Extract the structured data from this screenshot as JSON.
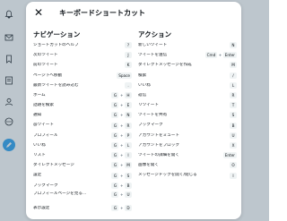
{
  "modal": {
    "title": "キーボードショートカット",
    "close_glyph": "✕"
  },
  "background_icons": [
    "bell-icon",
    "mail-icon",
    "bookmark-icon",
    "list-icon",
    "profile-icon",
    "more-icon"
  ],
  "navigation": {
    "heading": "ナビゲーション",
    "rows": [
      {
        "label": "ショートカットのヘルプ",
        "keys": [
          "?"
        ]
      },
      {
        "label": "次のツイート",
        "keys": [
          "J"
        ]
      },
      {
        "label": "前のツイート",
        "keys": [
          "K"
        ]
      },
      {
        "label": "ページ下へ移動",
        "keys": [
          "Space"
        ]
      },
      {
        "label": "最新ツイートを読み込む",
        "keys": [
          "."
        ]
      },
      {
        "label": "ホーム",
        "keys": [
          "G",
          "H"
        ]
      },
      {
        "label": "話題を検索",
        "keys": [
          "G",
          "E"
        ]
      },
      {
        "label": "通知",
        "keys": [
          "G",
          "N"
        ]
      },
      {
        "label": "@ツイート",
        "keys": [
          "G",
          "R"
        ]
      },
      {
        "label": "プロフィール",
        "keys": [
          "G",
          "P"
        ]
      },
      {
        "label": "いいね",
        "keys": [
          "G",
          "L"
        ]
      },
      {
        "label": "リスト",
        "keys": [
          "G",
          "I"
        ]
      },
      {
        "label": "ダイレクトメッセージ",
        "keys": [
          "G",
          "M"
        ]
      },
      {
        "label": "設定",
        "keys": [
          "G",
          "S"
        ]
      },
      {
        "label": "ブックマーク",
        "keys": [
          "G",
          "B"
        ]
      },
      {
        "label": "プロフィールページを見る...",
        "keys": [
          "G",
          "U"
        ]
      },
      {
        "label": "表示設定",
        "keys": [
          "G",
          "D"
        ]
      }
    ]
  },
  "actions": {
    "heading": "アクション",
    "rows": [
      {
        "label": "新しいツイート",
        "keys": [
          "N"
        ]
      },
      {
        "label": "ツイートを送信",
        "keys": [
          "Cmd",
          "Enter"
        ]
      },
      {
        "label": "ダイレクトメッセージを作成",
        "keys": [
          "M"
        ]
      },
      {
        "label": "検索",
        "keys": [
          "/"
        ]
      },
      {
        "label": "いいね",
        "keys": [
          "L"
        ]
      },
      {
        "label": "返信",
        "keys": [
          "R"
        ]
      },
      {
        "label": "リツイート",
        "keys": [
          "T"
        ]
      },
      {
        "label": "ツイートを共有",
        "keys": [
          "S"
        ]
      },
      {
        "label": "ブックマーク",
        "keys": [
          "B"
        ]
      },
      {
        "label": "アカウントをミュート",
        "keys": [
          "U"
        ]
      },
      {
        "label": "アカウントをブロック",
        "keys": [
          "X"
        ]
      },
      {
        "label": "ツイートの詳細を開く",
        "keys": [
          "Enter"
        ]
      },
      {
        "label": "画像を開く",
        "keys": [
          "O"
        ]
      },
      {
        "label": "メッセージドックを開く/閉じる",
        "keys": [
          "I"
        ]
      }
    ]
  }
}
